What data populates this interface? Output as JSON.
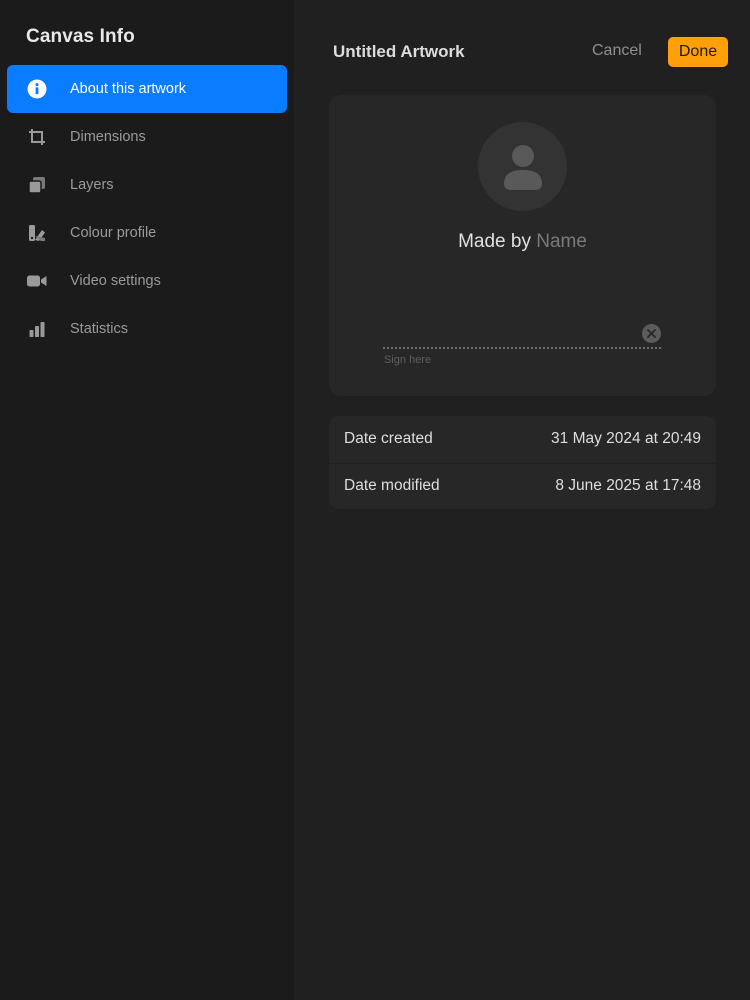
{
  "sidebar": {
    "title": "Canvas Info",
    "items": [
      {
        "label": "About this artwork",
        "icon": "info-icon",
        "active": true
      },
      {
        "label": "Dimensions",
        "icon": "crop-icon",
        "active": false
      },
      {
        "label": "Layers",
        "icon": "layers-icon",
        "active": false
      },
      {
        "label": "Colour profile",
        "icon": "colour-swatch-icon",
        "active": false
      },
      {
        "label": "Video settings",
        "icon": "video-camera-icon",
        "active": false
      },
      {
        "label": "Statistics",
        "icon": "bar-chart-icon",
        "active": false
      }
    ]
  },
  "header": {
    "title": "Untitled Artwork",
    "cancel_label": "Cancel",
    "done_label": "Done"
  },
  "author_card": {
    "made_by_prefix": "Made by",
    "name_placeholder": "Name",
    "sign_hint": "Sign here"
  },
  "info": {
    "rows": [
      {
        "label": "Date created",
        "value": "31 May 2024 at 20:49"
      },
      {
        "label": "Date modified",
        "value": "8 June 2025 at 17:48"
      }
    ]
  },
  "colors": {
    "accent": "#0a7cff",
    "done": "#ff9f0a",
    "background": "#202020",
    "sidebar": "#1b1b1b"
  }
}
